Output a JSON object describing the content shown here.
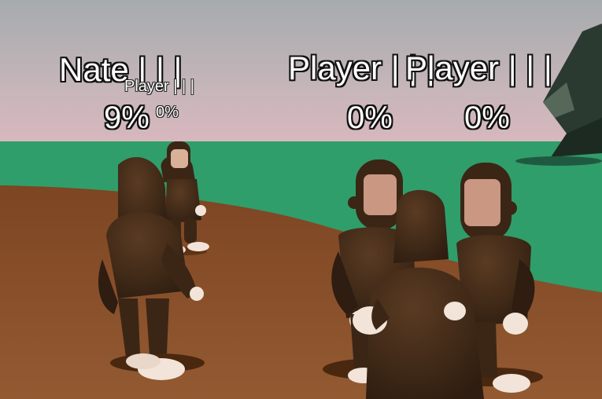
{
  "players": [
    {
      "name": "Nate | | |",
      "damage": "9%"
    },
    {
      "name": "Player | | |",
      "damage": "0%"
    },
    {
      "name": "Player | | |",
      "damage": "0%"
    },
    {
      "name": "Player | | |",
      "damage": "0%"
    }
  ],
  "colors": {
    "sky_top": "#a9adb0",
    "sky_bottom": "#d9b9bf",
    "grass": "#2f9e6a",
    "dirt": "#8a4f2a",
    "monkey": "#3b2616",
    "skin": "#f2e4d8"
  }
}
